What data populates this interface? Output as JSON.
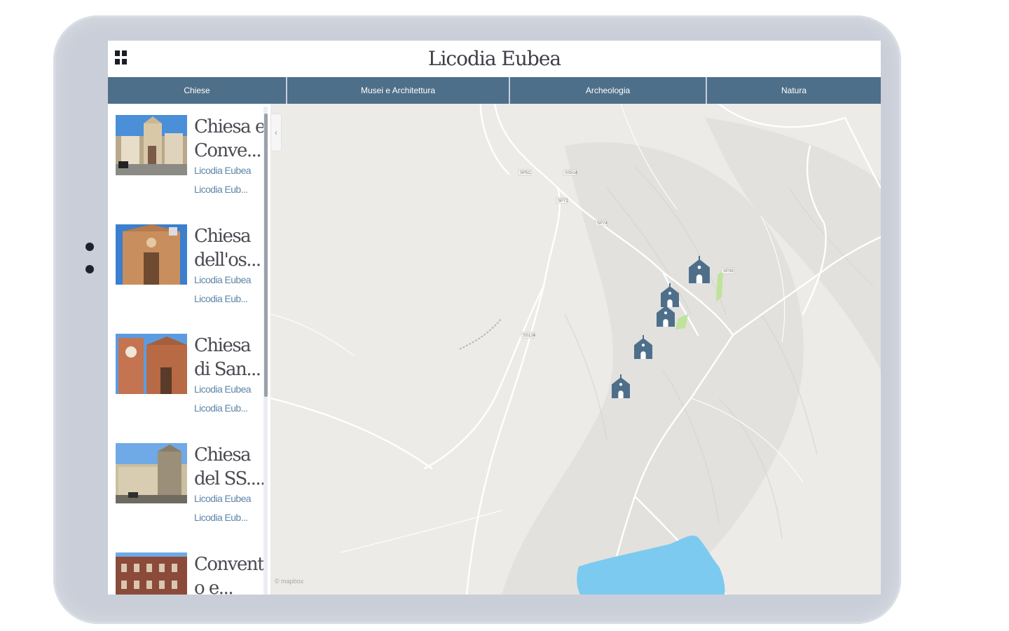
{
  "app": {
    "title": "Licodia Eubea"
  },
  "icons": {
    "menu": "grid-menu-icon",
    "marker": "church-marker-icon",
    "collapse": "chevron-left-icon"
  },
  "tabs": [
    {
      "label": "Chiese"
    },
    {
      "label": "Musei e Architettura"
    },
    {
      "label": "Archeologia"
    },
    {
      "label": "Natura"
    }
  ],
  "places": [
    {
      "title_line1": "Chiesa e",
      "title_line2": "Conve...",
      "town": "Licodia Eubea",
      "address": "Licodia Eub..."
    },
    {
      "title_line1": "Chiesa",
      "title_line2": "dell'os...",
      "town": "Licodia Eubea",
      "address": "Licodia Eub..."
    },
    {
      "title_line1": "Chiesa",
      "title_line2": "di San...",
      "town": "Licodia Eubea",
      "address": "Licodia Eub..."
    },
    {
      "title_line1": "Chiesa",
      "title_line2": "del SS....",
      "town": "Licodia Eubea",
      "address": "Licodia Eub..."
    },
    {
      "title_line1": "Convent",
      "title_line2": "o e...",
      "town": "",
      "address": ""
    }
  ],
  "map": {
    "attribution": "© mapbox",
    "road_labels": [
      "SP5C",
      "SS514",
      "SP72",
      "SP74",
      "SS124",
      "SP38"
    ],
    "colors": {
      "marker": "#4e6f8a",
      "water": "#7dcaf0",
      "land": "#ecebe8",
      "road": "#ffffff"
    }
  },
  "colors": {
    "accent": "#4e6f8a",
    "link": "#5f86a8",
    "frame": "#c9ced8"
  }
}
